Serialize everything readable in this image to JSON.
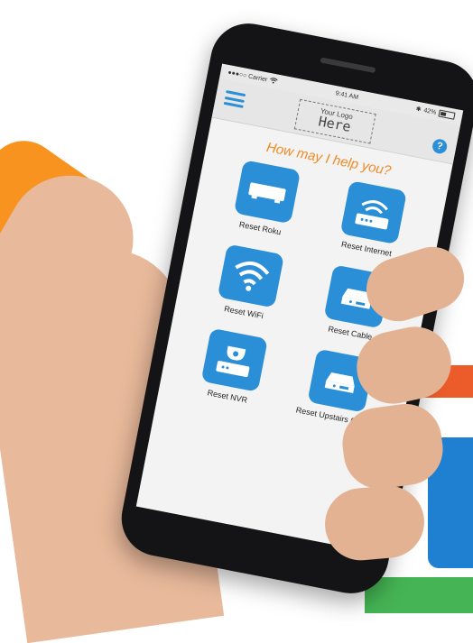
{
  "status_bar": {
    "carrier": "●●●○○ Carrier",
    "time": "9:41 AM",
    "battery": "42%"
  },
  "header": {
    "logo_line1": "Your Logo",
    "logo_line2": "Here",
    "help_glyph": "?"
  },
  "greeting": "How may I help you?",
  "tiles": [
    {
      "label": "Reset Roku",
      "icon": "set-top-box-icon"
    },
    {
      "label": "Reset Internet",
      "icon": "router-icon"
    },
    {
      "label": "Reset WiFi",
      "icon": "wifi-icon"
    },
    {
      "label": "Reset Cable",
      "icon": "cable-box-icon"
    },
    {
      "label": "Reset NVR",
      "icon": "nvr-camera-icon"
    },
    {
      "label": "Reset Upstairs Cable",
      "icon": "cable-box-icon"
    }
  ],
  "colors": {
    "accent": "#2b8fd8",
    "greeting": "#f08a24"
  }
}
